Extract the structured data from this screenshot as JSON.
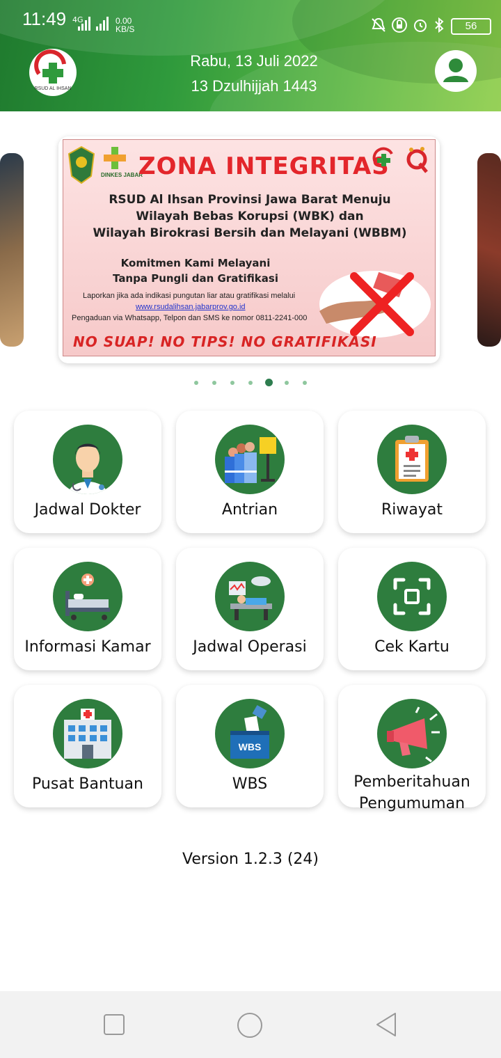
{
  "status_bar": {
    "time": "11:49",
    "network": "4G",
    "speed_value": "0.00",
    "speed_unit": "KB/S",
    "battery": "56"
  },
  "header": {
    "gregorian_date": "Rabu, 13 Juli 2022",
    "hijri_date": "13 Dzulhijjah 1443",
    "logo_text": "RSUD AL IHSAN",
    "colors": {
      "green_dark": "#1f7a2e",
      "green_light": "#8fce4a"
    }
  },
  "banner": {
    "left_logo_label": "DINKES JABAR",
    "title": "ZONA INTEGRITAS",
    "line1": "RSUD Al Ihsan Provinsi Jawa Barat Menuju",
    "line2": "Wilayah Bebas Korupsi (WBK) dan",
    "line3": "Wilayah Birokrasi Bersih dan Melayani (WBBM)",
    "commitment1": "Komitmen Kami Melayani",
    "commitment2": "Tanpa Pungli dan Gratifikasi",
    "report_text": "Laporkan jika ada indikasi pungutan liar atau gratifikasi melalui",
    "website": "www.rsudalihsan.jabarprov.go.id",
    "complaint_text": "Pengaduan via Whatsapp, Telpon dan SMS ke nomor 0811-2241-000",
    "slogan": "NO SUAP! NO TIPS! NO GRATIFIKASI"
  },
  "carousel": {
    "page_count": 7,
    "active_index": 4
  },
  "menu": [
    {
      "label": "Jadwal Dokter",
      "icon": "doctor-icon"
    },
    {
      "label": "Antrian",
      "icon": "queue-icon"
    },
    {
      "label": "Riwayat",
      "icon": "clipboard-icon"
    },
    {
      "label": "Informasi Kamar",
      "icon": "hospital-bed-icon"
    },
    {
      "label": "Jadwal Operasi",
      "icon": "operating-room-icon"
    },
    {
      "label": "Cek Kartu",
      "icon": "scan-card-icon"
    },
    {
      "label": "Pusat Bantuan",
      "icon": "hospital-building-icon"
    },
    {
      "label": "WBS",
      "icon": "ballot-box-icon",
      "badge": "WBS"
    },
    {
      "label_line1": "Pemberitahuan",
      "label_line2": "Pengumuman",
      "icon": "megaphone-icon"
    }
  ],
  "version": "Version 1.2.3 (24)"
}
